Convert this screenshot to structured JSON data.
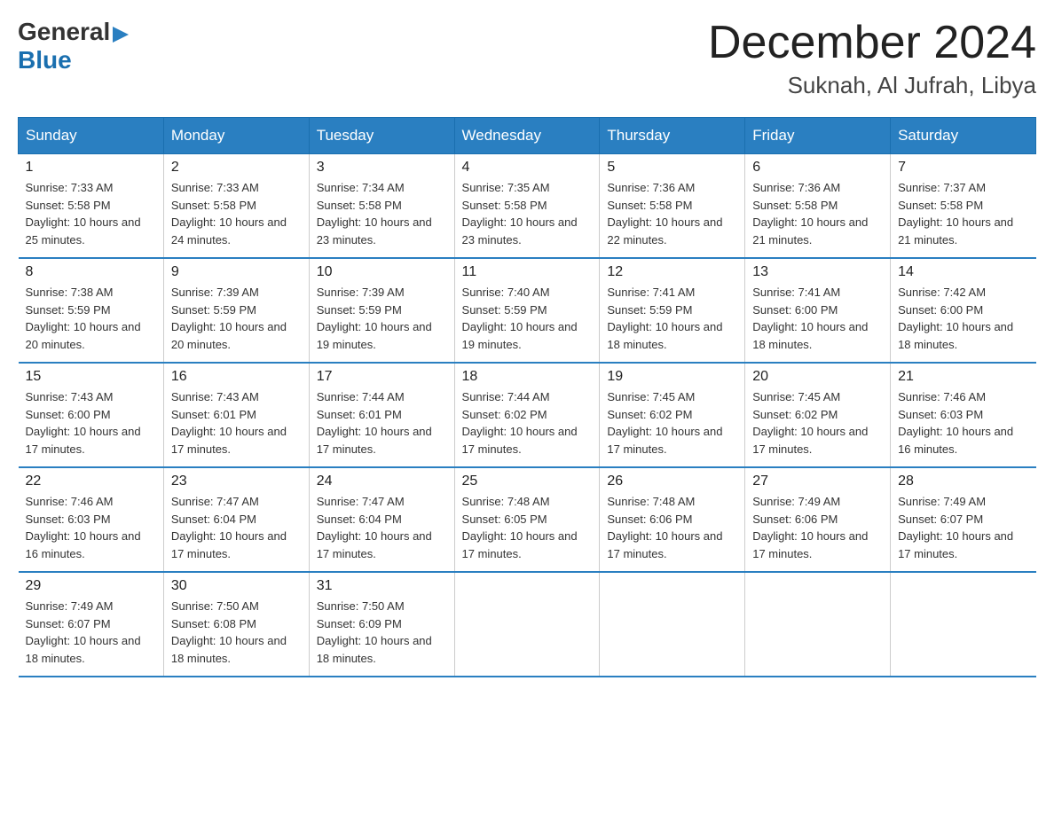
{
  "header": {
    "logo_general": "General",
    "logo_blue": "Blue",
    "month_title": "December 2024",
    "location": "Suknah, Al Jufrah, Libya"
  },
  "weekdays": [
    "Sunday",
    "Monday",
    "Tuesday",
    "Wednesday",
    "Thursday",
    "Friday",
    "Saturday"
  ],
  "weeks": [
    [
      {
        "day": "1",
        "sunrise": "7:33 AM",
        "sunset": "5:58 PM",
        "daylight": "10 hours and 25 minutes."
      },
      {
        "day": "2",
        "sunrise": "7:33 AM",
        "sunset": "5:58 PM",
        "daylight": "10 hours and 24 minutes."
      },
      {
        "day": "3",
        "sunrise": "7:34 AM",
        "sunset": "5:58 PM",
        "daylight": "10 hours and 23 minutes."
      },
      {
        "day": "4",
        "sunrise": "7:35 AM",
        "sunset": "5:58 PM",
        "daylight": "10 hours and 23 minutes."
      },
      {
        "day": "5",
        "sunrise": "7:36 AM",
        "sunset": "5:58 PM",
        "daylight": "10 hours and 22 minutes."
      },
      {
        "day": "6",
        "sunrise": "7:36 AM",
        "sunset": "5:58 PM",
        "daylight": "10 hours and 21 minutes."
      },
      {
        "day": "7",
        "sunrise": "7:37 AM",
        "sunset": "5:58 PM",
        "daylight": "10 hours and 21 minutes."
      }
    ],
    [
      {
        "day": "8",
        "sunrise": "7:38 AM",
        "sunset": "5:59 PM",
        "daylight": "10 hours and 20 minutes."
      },
      {
        "day": "9",
        "sunrise": "7:39 AM",
        "sunset": "5:59 PM",
        "daylight": "10 hours and 20 minutes."
      },
      {
        "day": "10",
        "sunrise": "7:39 AM",
        "sunset": "5:59 PM",
        "daylight": "10 hours and 19 minutes."
      },
      {
        "day": "11",
        "sunrise": "7:40 AM",
        "sunset": "5:59 PM",
        "daylight": "10 hours and 19 minutes."
      },
      {
        "day": "12",
        "sunrise": "7:41 AM",
        "sunset": "5:59 PM",
        "daylight": "10 hours and 18 minutes."
      },
      {
        "day": "13",
        "sunrise": "7:41 AM",
        "sunset": "6:00 PM",
        "daylight": "10 hours and 18 minutes."
      },
      {
        "day": "14",
        "sunrise": "7:42 AM",
        "sunset": "6:00 PM",
        "daylight": "10 hours and 18 minutes."
      }
    ],
    [
      {
        "day": "15",
        "sunrise": "7:43 AM",
        "sunset": "6:00 PM",
        "daylight": "10 hours and 17 minutes."
      },
      {
        "day": "16",
        "sunrise": "7:43 AM",
        "sunset": "6:01 PM",
        "daylight": "10 hours and 17 minutes."
      },
      {
        "day": "17",
        "sunrise": "7:44 AM",
        "sunset": "6:01 PM",
        "daylight": "10 hours and 17 minutes."
      },
      {
        "day": "18",
        "sunrise": "7:44 AM",
        "sunset": "6:02 PM",
        "daylight": "10 hours and 17 minutes."
      },
      {
        "day": "19",
        "sunrise": "7:45 AM",
        "sunset": "6:02 PM",
        "daylight": "10 hours and 17 minutes."
      },
      {
        "day": "20",
        "sunrise": "7:45 AM",
        "sunset": "6:02 PM",
        "daylight": "10 hours and 17 minutes."
      },
      {
        "day": "21",
        "sunrise": "7:46 AM",
        "sunset": "6:03 PM",
        "daylight": "10 hours and 16 minutes."
      }
    ],
    [
      {
        "day": "22",
        "sunrise": "7:46 AM",
        "sunset": "6:03 PM",
        "daylight": "10 hours and 16 minutes."
      },
      {
        "day": "23",
        "sunrise": "7:47 AM",
        "sunset": "6:04 PM",
        "daylight": "10 hours and 17 minutes."
      },
      {
        "day": "24",
        "sunrise": "7:47 AM",
        "sunset": "6:04 PM",
        "daylight": "10 hours and 17 minutes."
      },
      {
        "day": "25",
        "sunrise": "7:48 AM",
        "sunset": "6:05 PM",
        "daylight": "10 hours and 17 minutes."
      },
      {
        "day": "26",
        "sunrise": "7:48 AM",
        "sunset": "6:06 PM",
        "daylight": "10 hours and 17 minutes."
      },
      {
        "day": "27",
        "sunrise": "7:49 AM",
        "sunset": "6:06 PM",
        "daylight": "10 hours and 17 minutes."
      },
      {
        "day": "28",
        "sunrise": "7:49 AM",
        "sunset": "6:07 PM",
        "daylight": "10 hours and 17 minutes."
      }
    ],
    [
      {
        "day": "29",
        "sunrise": "7:49 AM",
        "sunset": "6:07 PM",
        "daylight": "10 hours and 18 minutes."
      },
      {
        "day": "30",
        "sunrise": "7:50 AM",
        "sunset": "6:08 PM",
        "daylight": "10 hours and 18 minutes."
      },
      {
        "day": "31",
        "sunrise": "7:50 AM",
        "sunset": "6:09 PM",
        "daylight": "10 hours and 18 minutes."
      },
      null,
      null,
      null,
      null
    ]
  ]
}
